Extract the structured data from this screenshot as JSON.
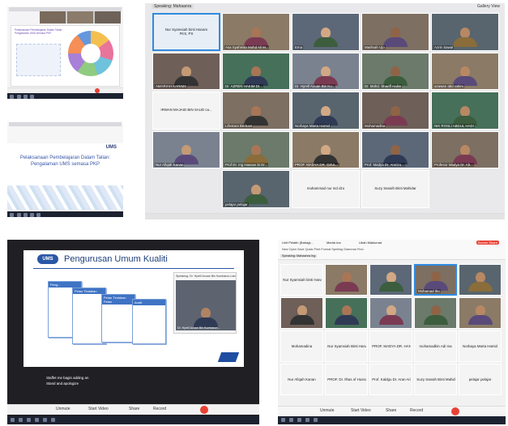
{
  "top_left_a": {
    "slide_title": "Pelaksanaan Pembelajaran Dalam Talian: Pengalaman UMS semasa PKP",
    "colors": {
      "slide_bg": "#ffffff",
      "accent": "#6a4fb3"
    }
  },
  "top_left_b": {
    "logo": "UMS",
    "slide_title": "Pelaksanaan Pembelajaran Dalam Talian: Pengalaman UMS semasa PKP"
  },
  "gallery_top": {
    "header": "Speaking: Mahaanra",
    "view_label": "Gallery View",
    "participants": [
      "Nur Syamsiah binti Hanam FKS, PS",
      "Asa Syahmila Mohd Ali M...",
      "Ema",
      "Marlinah Ujo",
      "Azrin Sawal",
      "AMARIAH KARIMS",
      "Dr. AZREN HAKIM DI...",
      "Dr. Hyrell Azuan Bin Ku...",
      "Dr. Mohd. Shariff Halim",
      "azawan abd rahim",
      "IRWAN MAJAID BIN SAUD ca...",
      "Lifestara Berbant",
      "Norbaya Marta Hamid",
      "Mohamadina",
      "NIK ROSLI ABDUL HADI",
      "Nur Afiqah Kanan",
      "Prof Dr. Ing Hassan bi Dr...",
      "PROF. MADYA DR. DZUL...",
      "Prof. Madya Dr. Amrizo...",
      "Profesor Madya Dr. Ab...",
      "pelajar pelajar",
      "muhammad nur md dzo",
      "Suzy Sanaih Binti Mahidar"
    ]
  },
  "shared_screen": {
    "slide_title": "Pengurusan Umum Kualiti",
    "logo": "UMS",
    "boxes": [
      "Peng...",
      "Pelan Tindakan",
      "Pelan Tindakan Pelan",
      "Audit"
    ],
    "speaker_header": "Speaking: Dr. Hyrell Azuan Bin Kumbarun Lamin",
    "speaker_name": "Dr. Hyrell Azuan Bin Kumbarun...",
    "caption": "Staffet me bagin adding an\nStand and apologize",
    "controls": [
      "Unmute",
      "Start Video",
      "Share",
      "Record"
    ]
  },
  "gallery_bottom": {
    "tabs": [
      "Unit Pelatih (Bahagi...",
      "Media Ina",
      "Ubah Maklumat"
    ],
    "toolbar": "New  Open  Save  Quick  Print  Format  Spelling  Grammar  Find",
    "speaker_label": "Speaking: Mahaanra Ing",
    "share_button": "Screen Share",
    "participants": [
      "Nur Syamsiah binti Hanam",
      "",
      "",
      "Mohamad Ibu",
      "",
      "",
      "",
      "",
      "",
      "",
      "Mohamadina",
      "Nur Syamsiah Binti Hanam",
      "PROF. MADYA DR. HANAFI ba...",
      "mohamadbin Adi Ina",
      "Norbaya Marta Hamid",
      "Nur Afiqah Kanan",
      "PROF. Dr. Ilhas of Hussain",
      "Prof. Kaldgu Dr. Aran Arinka",
      "Suzy Sanaih Binti Mahidar",
      "pelajar pelajar"
    ],
    "controls": [
      "Unmute",
      "Start Video",
      "Share",
      "Record"
    ]
  }
}
